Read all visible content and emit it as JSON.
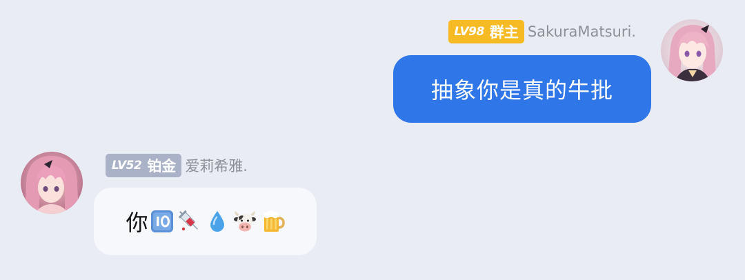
{
  "messages": [
    {
      "side": "right",
      "level": "LV98",
      "role_title": "群主",
      "sender": "SakuraMatsuri.",
      "text": "抽象你是真的牛批",
      "badge_color": "#f6bb24",
      "bubble_color": "#2f76e8"
    },
    {
      "side": "left",
      "level": "LV52",
      "role_title": "铂金",
      "sender": "爱莉希雅.",
      "text": "你",
      "emojis": [
        "keycap-ten-icon",
        "syringe-icon",
        "droplet-icon",
        "cow-face-icon",
        "beer-mug-icon"
      ],
      "badge_color": "#a9b2c6",
      "bubble_color": "#f6f8fc"
    }
  ],
  "background_color": "#eaecf3"
}
